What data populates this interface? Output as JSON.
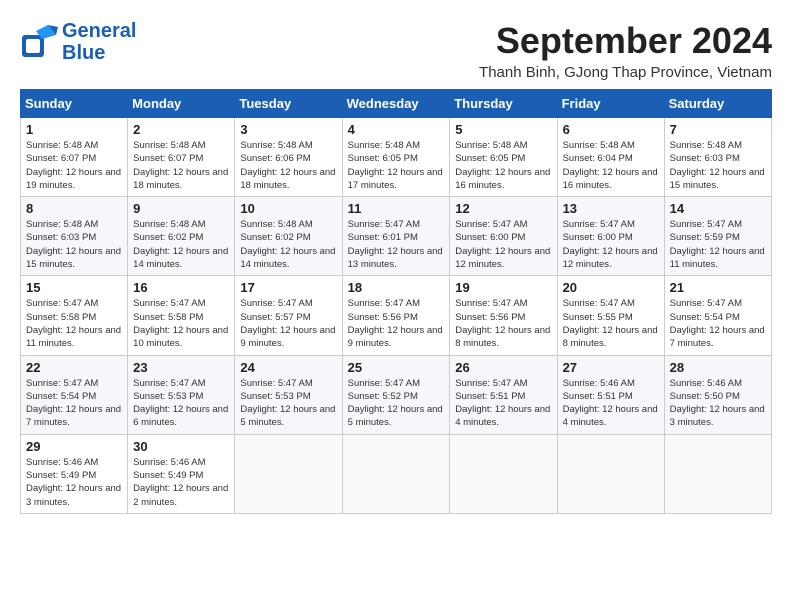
{
  "header": {
    "logo_line1": "General",
    "logo_line2": "Blue",
    "month": "September 2024",
    "location": "Thanh Binh, GJong Thap Province, Vietnam"
  },
  "weekdays": [
    "Sunday",
    "Monday",
    "Tuesday",
    "Wednesday",
    "Thursday",
    "Friday",
    "Saturday"
  ],
  "weeks": [
    [
      {
        "day": "1",
        "sunrise": "5:48 AM",
        "sunset": "6:07 PM",
        "daylight": "12 hours and 19 minutes."
      },
      {
        "day": "2",
        "sunrise": "5:48 AM",
        "sunset": "6:07 PM",
        "daylight": "12 hours and 18 minutes."
      },
      {
        "day": "3",
        "sunrise": "5:48 AM",
        "sunset": "6:06 PM",
        "daylight": "12 hours and 18 minutes."
      },
      {
        "day": "4",
        "sunrise": "5:48 AM",
        "sunset": "6:05 PM",
        "daylight": "12 hours and 17 minutes."
      },
      {
        "day": "5",
        "sunrise": "5:48 AM",
        "sunset": "6:05 PM",
        "daylight": "12 hours and 16 minutes."
      },
      {
        "day": "6",
        "sunrise": "5:48 AM",
        "sunset": "6:04 PM",
        "daylight": "12 hours and 16 minutes."
      },
      {
        "day": "7",
        "sunrise": "5:48 AM",
        "sunset": "6:03 PM",
        "daylight": "12 hours and 15 minutes."
      }
    ],
    [
      {
        "day": "8",
        "sunrise": "5:48 AM",
        "sunset": "6:03 PM",
        "daylight": "12 hours and 15 minutes."
      },
      {
        "day": "9",
        "sunrise": "5:48 AM",
        "sunset": "6:02 PM",
        "daylight": "12 hours and 14 minutes."
      },
      {
        "day": "10",
        "sunrise": "5:48 AM",
        "sunset": "6:02 PM",
        "daylight": "12 hours and 14 minutes."
      },
      {
        "day": "11",
        "sunrise": "5:47 AM",
        "sunset": "6:01 PM",
        "daylight": "12 hours and 13 minutes."
      },
      {
        "day": "12",
        "sunrise": "5:47 AM",
        "sunset": "6:00 PM",
        "daylight": "12 hours and 12 minutes."
      },
      {
        "day": "13",
        "sunrise": "5:47 AM",
        "sunset": "6:00 PM",
        "daylight": "12 hours and 12 minutes."
      },
      {
        "day": "14",
        "sunrise": "5:47 AM",
        "sunset": "5:59 PM",
        "daylight": "12 hours and 11 minutes."
      }
    ],
    [
      {
        "day": "15",
        "sunrise": "5:47 AM",
        "sunset": "5:58 PM",
        "daylight": "12 hours and 11 minutes."
      },
      {
        "day": "16",
        "sunrise": "5:47 AM",
        "sunset": "5:58 PM",
        "daylight": "12 hours and 10 minutes."
      },
      {
        "day": "17",
        "sunrise": "5:47 AM",
        "sunset": "5:57 PM",
        "daylight": "12 hours and 9 minutes."
      },
      {
        "day": "18",
        "sunrise": "5:47 AM",
        "sunset": "5:56 PM",
        "daylight": "12 hours and 9 minutes."
      },
      {
        "day": "19",
        "sunrise": "5:47 AM",
        "sunset": "5:56 PM",
        "daylight": "12 hours and 8 minutes."
      },
      {
        "day": "20",
        "sunrise": "5:47 AM",
        "sunset": "5:55 PM",
        "daylight": "12 hours and 8 minutes."
      },
      {
        "day": "21",
        "sunrise": "5:47 AM",
        "sunset": "5:54 PM",
        "daylight": "12 hours and 7 minutes."
      }
    ],
    [
      {
        "day": "22",
        "sunrise": "5:47 AM",
        "sunset": "5:54 PM",
        "daylight": "12 hours and 7 minutes."
      },
      {
        "day": "23",
        "sunrise": "5:47 AM",
        "sunset": "5:53 PM",
        "daylight": "12 hours and 6 minutes."
      },
      {
        "day": "24",
        "sunrise": "5:47 AM",
        "sunset": "5:53 PM",
        "daylight": "12 hours and 5 minutes."
      },
      {
        "day": "25",
        "sunrise": "5:47 AM",
        "sunset": "5:52 PM",
        "daylight": "12 hours and 5 minutes."
      },
      {
        "day": "26",
        "sunrise": "5:47 AM",
        "sunset": "5:51 PM",
        "daylight": "12 hours and 4 minutes."
      },
      {
        "day": "27",
        "sunrise": "5:46 AM",
        "sunset": "5:51 PM",
        "daylight": "12 hours and 4 minutes."
      },
      {
        "day": "28",
        "sunrise": "5:46 AM",
        "sunset": "5:50 PM",
        "daylight": "12 hours and 3 minutes."
      }
    ],
    [
      {
        "day": "29",
        "sunrise": "5:46 AM",
        "sunset": "5:49 PM",
        "daylight": "12 hours and 3 minutes."
      },
      {
        "day": "30",
        "sunrise": "5:46 AM",
        "sunset": "5:49 PM",
        "daylight": "12 hours and 2 minutes."
      },
      null,
      null,
      null,
      null,
      null
    ]
  ]
}
